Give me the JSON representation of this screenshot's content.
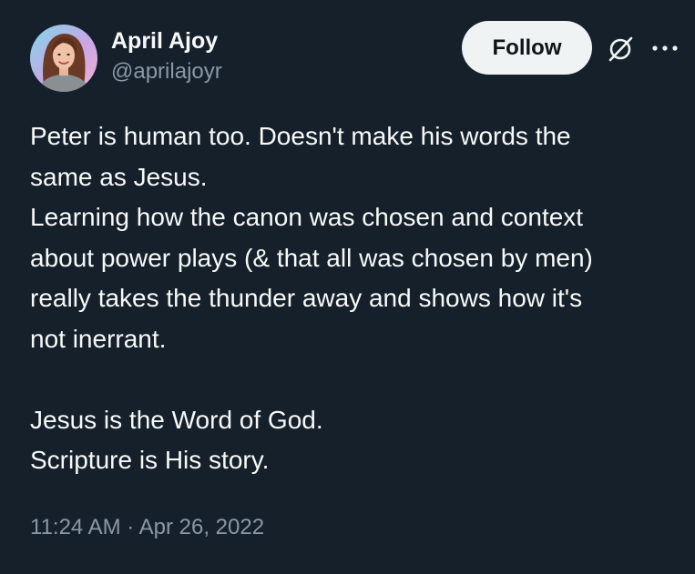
{
  "author": {
    "name": "April Ajoy",
    "handle": "@aprilajoyr"
  },
  "actions": {
    "follow_label": "Follow",
    "grok_icon": "grok-slash-circle-icon",
    "more_icon": "more-horizontal-icon"
  },
  "tweet": {
    "lines": [
      "Peter is human too. Doesn't make his words the",
      "same as Jesus.",
      "Learning how the canon was chosen and context",
      "about power plays (& that all was chosen by men)",
      "really takes the thunder away and shows how it's",
      "not inerrant.",
      "",
      "Jesus is the Word of God.",
      "Scripture is His story."
    ],
    "timestamp": "11:24 AM · Apr 26, 2022"
  },
  "colors": {
    "background": "#15202b",
    "text": "#f7f9f9",
    "muted": "#8b98a5",
    "button_bg": "#eff3f4",
    "button_text": "#0f1419"
  }
}
